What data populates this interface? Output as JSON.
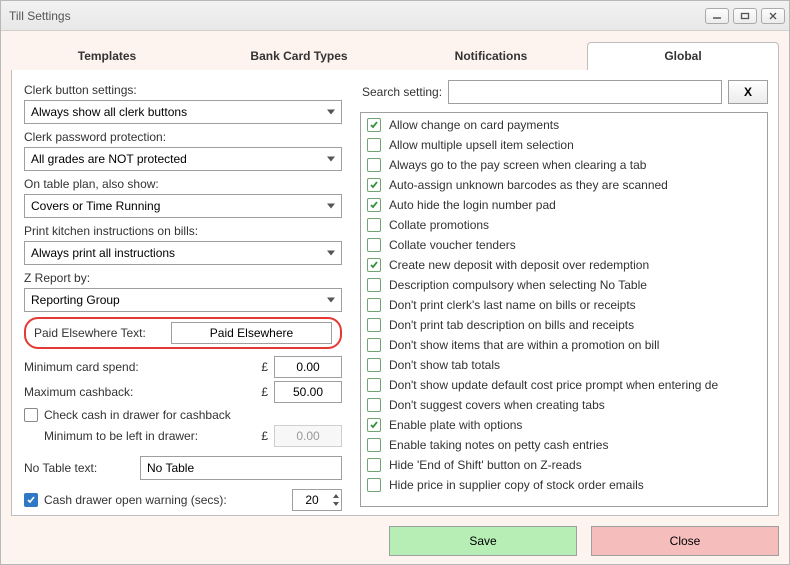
{
  "window": {
    "title": "Till Settings"
  },
  "tabs": [
    "Templates",
    "Bank Card Types",
    "Notifications",
    "Global"
  ],
  "active_tab_index": 3,
  "left": {
    "clerk_button_label": "Clerk button settings:",
    "clerk_button_value": "Always show all clerk buttons",
    "clerk_password_label": "Clerk password protection:",
    "clerk_password_value": "All grades are NOT protected",
    "table_plan_label": "On table plan, also show:",
    "table_plan_value": "Covers or Time Running",
    "kitchen_label": "Print kitchen instructions on bills:",
    "kitchen_value": "Always print all instructions",
    "zreport_label": "Z Report by:",
    "zreport_value": "Reporting Group",
    "paid_elsewhere_label": "Paid Elsewhere Text:",
    "paid_elsewhere_value": "Paid Elsewhere",
    "min_card_label": "Minimum card spend:",
    "min_card_currency": "£",
    "min_card_value": "0.00",
    "max_cashback_label": "Maximum cashback:",
    "max_cashback_currency": "£",
    "max_cashback_value": "50.00",
    "check_cash_label": "Check cash in drawer for cashback",
    "check_cash_checked": false,
    "min_left_label": "Minimum to be left in drawer:",
    "min_left_currency": "£",
    "min_left_value": "0.00",
    "no_table_label": "No Table text:",
    "no_table_value": "No Table",
    "cash_drawer_label": "Cash drawer open warning (secs):",
    "cash_drawer_checked": true,
    "cash_drawer_value": "20"
  },
  "search": {
    "label": "Search setting:",
    "value": "",
    "clear": "X"
  },
  "settings": [
    {
      "label": "Allow change on card payments",
      "checked": true
    },
    {
      "label": "Allow multiple upsell item selection",
      "checked": false
    },
    {
      "label": "Always go to the pay screen when clearing a tab",
      "checked": false
    },
    {
      "label": "Auto-assign unknown barcodes as they are scanned",
      "checked": true
    },
    {
      "label": "Auto hide the login number pad",
      "checked": true
    },
    {
      "label": "Collate promotions",
      "checked": false
    },
    {
      "label": "Collate voucher tenders",
      "checked": false
    },
    {
      "label": "Create new deposit with deposit over redemption",
      "checked": true
    },
    {
      "label": "Description compulsory when selecting No Table",
      "checked": false
    },
    {
      "label": "Don't print clerk's last name on bills or receipts",
      "checked": false
    },
    {
      "label": "Don't print tab description on bills and receipts",
      "checked": false
    },
    {
      "label": "Don't show items that are within a promotion on bill",
      "checked": false
    },
    {
      "label": "Don't show tab totals",
      "checked": false
    },
    {
      "label": "Don't show update default cost price prompt when entering de",
      "checked": false
    },
    {
      "label": "Don't suggest covers when creating tabs",
      "checked": false
    },
    {
      "label": "Enable plate with options",
      "checked": true
    },
    {
      "label": "Enable taking notes on petty cash entries",
      "checked": false
    },
    {
      "label": "Hide 'End of Shift' button on Z-reads",
      "checked": false
    },
    {
      "label": "Hide price in supplier copy of stock order emails",
      "checked": false
    }
  ],
  "footer": {
    "save": "Save",
    "close": "Close"
  }
}
